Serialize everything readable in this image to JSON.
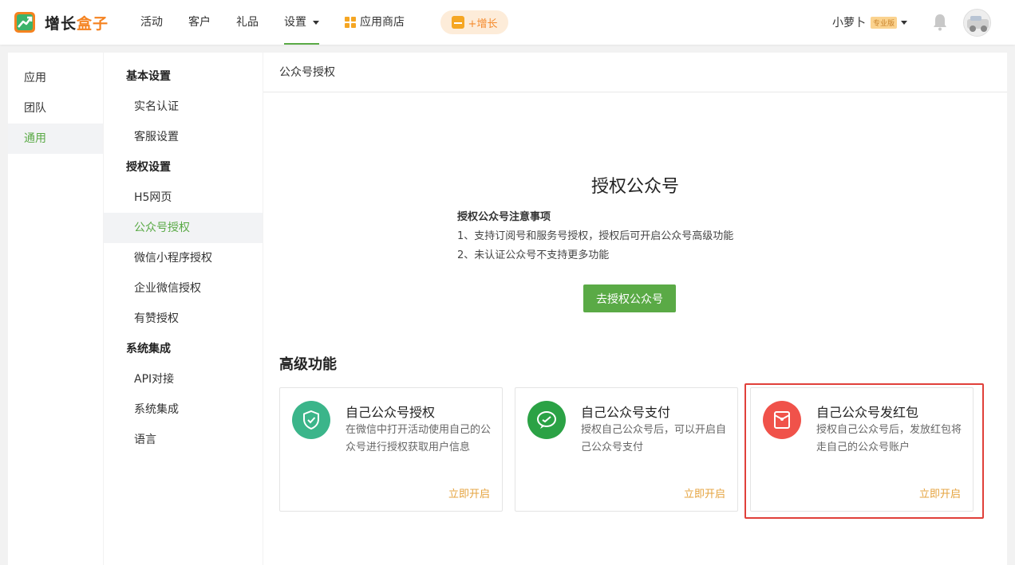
{
  "header": {
    "logo_text_a": "增长",
    "logo_text_b": "盒子",
    "nav": [
      {
        "label": "活动"
      },
      {
        "label": "客户"
      },
      {
        "label": "礼品"
      },
      {
        "label": "设置"
      },
      {
        "label": "应用商店"
      }
    ],
    "grow_label": "+增长",
    "user_name": "小萝卜",
    "user_badge": "专业版"
  },
  "sidebar1": {
    "items": [
      {
        "label": "应用"
      },
      {
        "label": "团队"
      },
      {
        "label": "通用"
      }
    ]
  },
  "sidebar2": {
    "groups": [
      {
        "title": "基本设置",
        "items": [
          "实名认证",
          "客服设置"
        ]
      },
      {
        "title": "授权设置",
        "items": [
          "H5网页",
          "公众号授权",
          "微信小程序授权",
          "企业微信授权",
          "有赞授权"
        ]
      },
      {
        "title": "系统集成",
        "items": [
          "API对接",
          "系统集成",
          "语言"
        ]
      }
    ]
  },
  "main": {
    "breadcrumb": "公众号授权",
    "auth_title": "授权公众号",
    "notes_title": "授权公众号注意事项",
    "note1": "1、支持订阅号和服务号授权，授权后可开启公众号高级功能",
    "note2": "2、未认证公众号不支持更多功能",
    "auth_button": "去授权公众号",
    "advanced_title": "高级功能",
    "cards": [
      {
        "title": "自己公众号授权",
        "desc": "在微信中打开活动使用自己的公众号进行授权获取用户信息",
        "link": "立即开启",
        "icon": "shield-check-icon"
      },
      {
        "title": "自己公众号支付",
        "desc": "授权自己公众号后，可以开启自己公众号支付",
        "link": "立即开启",
        "icon": "wechat-pay-icon"
      },
      {
        "title": "自己公众号发红包",
        "desc": "授权自己公众号后，发放红包将走自己的公众号账户",
        "link": "立即开启",
        "icon": "red-packet-icon"
      }
    ]
  },
  "colors": {
    "brand_green": "#5aaa46",
    "accent_orange": "#f5821f",
    "link_orange": "#e5a33e",
    "highlight_red": "#e0403a"
  }
}
